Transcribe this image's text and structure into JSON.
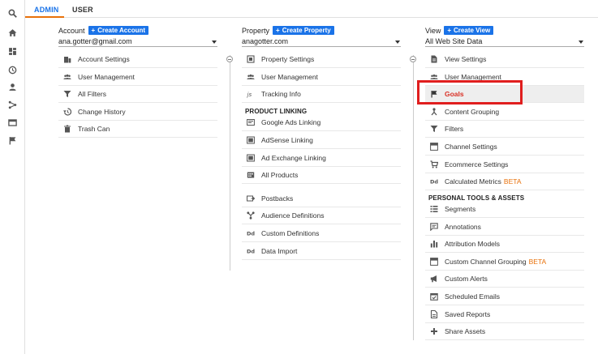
{
  "tabs": {
    "admin": "ADMIN",
    "user": "USER"
  },
  "rail": [
    "search-icon",
    "home-icon",
    "dashboard-icon",
    "clock-icon",
    "person-icon",
    "acquisition-icon",
    "behavior-icon",
    "flag-icon"
  ],
  "account": {
    "title": "Account",
    "create_label": "Create Account",
    "selected": "ana.gotter@gmail.com",
    "items": [
      {
        "label": "Account Settings",
        "icon": "building-icon"
      },
      {
        "label": "User Management",
        "icon": "users-icon"
      },
      {
        "label": "All Filters",
        "icon": "filter-icon"
      },
      {
        "label": "Change History",
        "icon": "history-icon"
      },
      {
        "label": "Trash Can",
        "icon": "trash-icon"
      }
    ]
  },
  "property": {
    "title": "Property",
    "create_label": "Create Property",
    "selected": "anagotter.com",
    "items": [
      {
        "label": "Property Settings",
        "icon": "settings-square-icon"
      },
      {
        "label": "User Management",
        "icon": "users-icon"
      },
      {
        "label": "Tracking Info",
        "icon": "js-icon"
      }
    ],
    "section_label": "PRODUCT LINKING",
    "linking": [
      {
        "label": "Google Ads Linking",
        "icon": "link-square-icon"
      },
      {
        "label": "AdSense Linking",
        "icon": "link-square-icon"
      },
      {
        "label": "Ad Exchange Linking",
        "icon": "link-square-icon"
      },
      {
        "label": "All Products",
        "icon": "grid-icon"
      }
    ],
    "more": [
      {
        "label": "Postbacks",
        "icon": "postback-icon"
      },
      {
        "label": "Audience Definitions",
        "icon": "audience-icon"
      },
      {
        "label": "Custom Definitions",
        "icon": "dd-icon"
      },
      {
        "label": "Data Import",
        "icon": "dd-icon"
      }
    ]
  },
  "view": {
    "title": "View",
    "create_label": "Create View",
    "selected": "All Web Site Data",
    "items": [
      {
        "label": "View Settings",
        "icon": "document-icon"
      },
      {
        "label": "User Management",
        "icon": "users-icon"
      },
      {
        "label": "Goals",
        "icon": "flag-icon"
      },
      {
        "label": "Content Grouping",
        "icon": "content-group-icon"
      },
      {
        "label": "Filters",
        "icon": "filter-icon"
      },
      {
        "label": "Channel Settings",
        "icon": "channel-icon"
      },
      {
        "label": "Ecommerce Settings",
        "icon": "cart-icon"
      },
      {
        "label": "Calculated Metrics",
        "icon": "dd-icon",
        "badge": "BETA"
      }
    ],
    "section_label": "PERSONAL TOOLS & ASSETS",
    "tools": [
      {
        "label": "Segments",
        "icon": "segments-icon"
      },
      {
        "label": "Annotations",
        "icon": "annotation-icon"
      },
      {
        "label": "Attribution Models",
        "icon": "bar-chart-icon"
      },
      {
        "label": "Custom Channel Grouping",
        "icon": "channel-icon",
        "badge": "BETA"
      },
      {
        "label": "Custom Alerts",
        "icon": "megaphone-icon"
      },
      {
        "label": "Scheduled Emails",
        "icon": "calendar-icon"
      },
      {
        "label": "Saved Reports",
        "icon": "report-icon"
      },
      {
        "label": "Share Assets",
        "icon": "share-icon"
      }
    ]
  },
  "colors": {
    "accent": "#1a73e8",
    "tab_underline": "#e8710a",
    "beta": "#e8710a",
    "highlight_box": "#e01e1e"
  }
}
